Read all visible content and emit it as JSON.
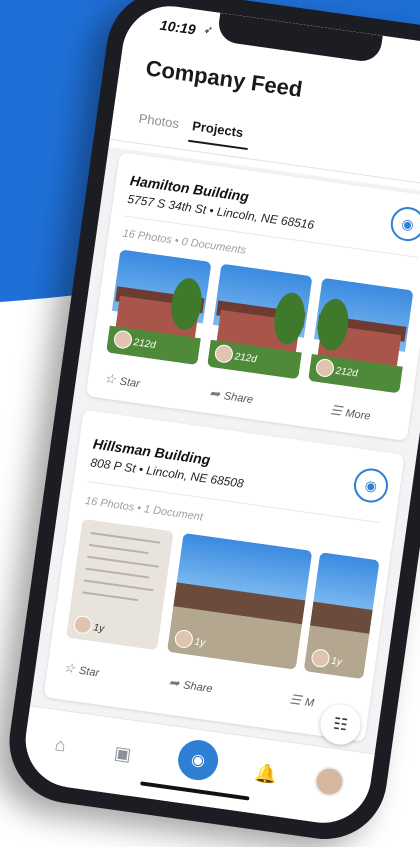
{
  "status": {
    "time": "10:19"
  },
  "header": {
    "title": "Company Feed",
    "tabs": [
      {
        "label": "Photos"
      },
      {
        "label": "Projects",
        "active": true
      }
    ]
  },
  "projects": [
    {
      "name": "Hamilton Building",
      "address": "5757 S 34th St • Lincoln, NE 68516",
      "counts": "16 Photos • 0 Documents",
      "photos": [
        {
          "age": "212d"
        },
        {
          "age": "212d"
        },
        {
          "age": "212d"
        }
      ],
      "actions": {
        "star": "Star",
        "share": "Share",
        "more": "More"
      }
    },
    {
      "name": "Hillsman Building",
      "address": "808 P St • Lincoln, NE 68508",
      "counts": "16 Photos • 1 Document",
      "photos": [
        {
          "age": "1y"
        },
        {
          "age": "1y"
        },
        {
          "age": "1y"
        }
      ],
      "actions": {
        "star": "Star",
        "share": "Share",
        "more": "M"
      }
    }
  ],
  "colors": {
    "brand_blue": "#1f6fd6",
    "accent": "#2f7fd4"
  },
  "icons": {
    "status_arrow": "location-arrow-icon",
    "people": "people-icon",
    "camera": "camera-icon",
    "filter": "sliders-icon",
    "home": "home-icon",
    "gallery": "gallery-icon",
    "bell": "bell-icon"
  }
}
